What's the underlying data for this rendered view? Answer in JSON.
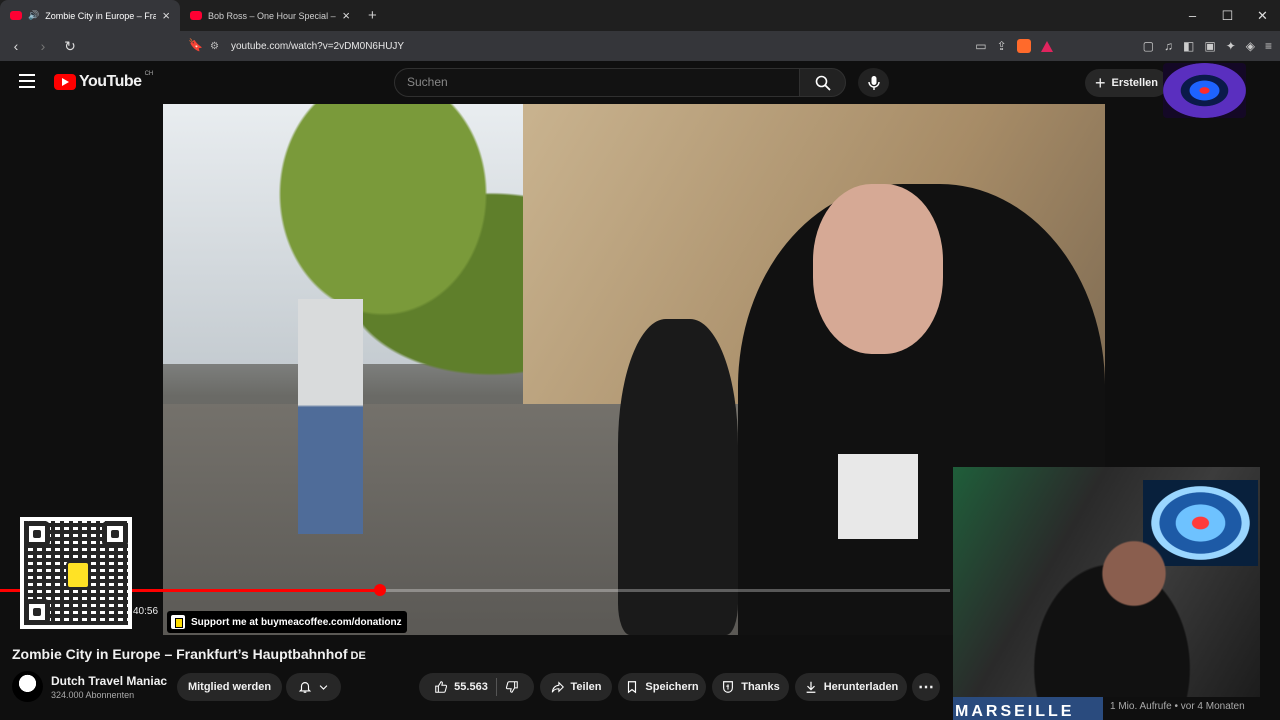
{
  "browser": {
    "tabs": [
      {
        "label": "Zombie City in Europe – Frankfurt's",
        "active": true
      },
      {
        "label": "Bob Ross – One Hour Special – The G",
        "active": false
      }
    ],
    "url": "youtube.com/watch?v=2vDM0N6HUJY"
  },
  "youtube": {
    "logo_text": "YouTube",
    "country_code": "CH",
    "search_placeholder": "Suchen",
    "create_label": "Erstellen"
  },
  "player": {
    "progress_fraction": 0.4,
    "time": "40:56",
    "support_text": "Support me at buymeacoffee.com/donationz"
  },
  "video": {
    "title": "Zombie City in Europe – Frankfurt’s Hauptbahnhof",
    "title_lang": "DE",
    "channel_name": "Dutch Travel Maniac",
    "subscribers": "324.000 Abonnenten",
    "member_label": "Mitglied werden",
    "likes": "55.563",
    "share_label": "Teilen",
    "save_label": "Speichern",
    "thanks_label": "Thanks",
    "download_label": "Herunterladen"
  },
  "sidebar_preview": {
    "overlay_text": "MARSEILLE",
    "views_text": "1 Mio. Aufrufe • vor 4 Monaten"
  },
  "colors": {
    "accent": "#ff0000",
    "background": "#0f0f0f",
    "pill": "#272727"
  }
}
